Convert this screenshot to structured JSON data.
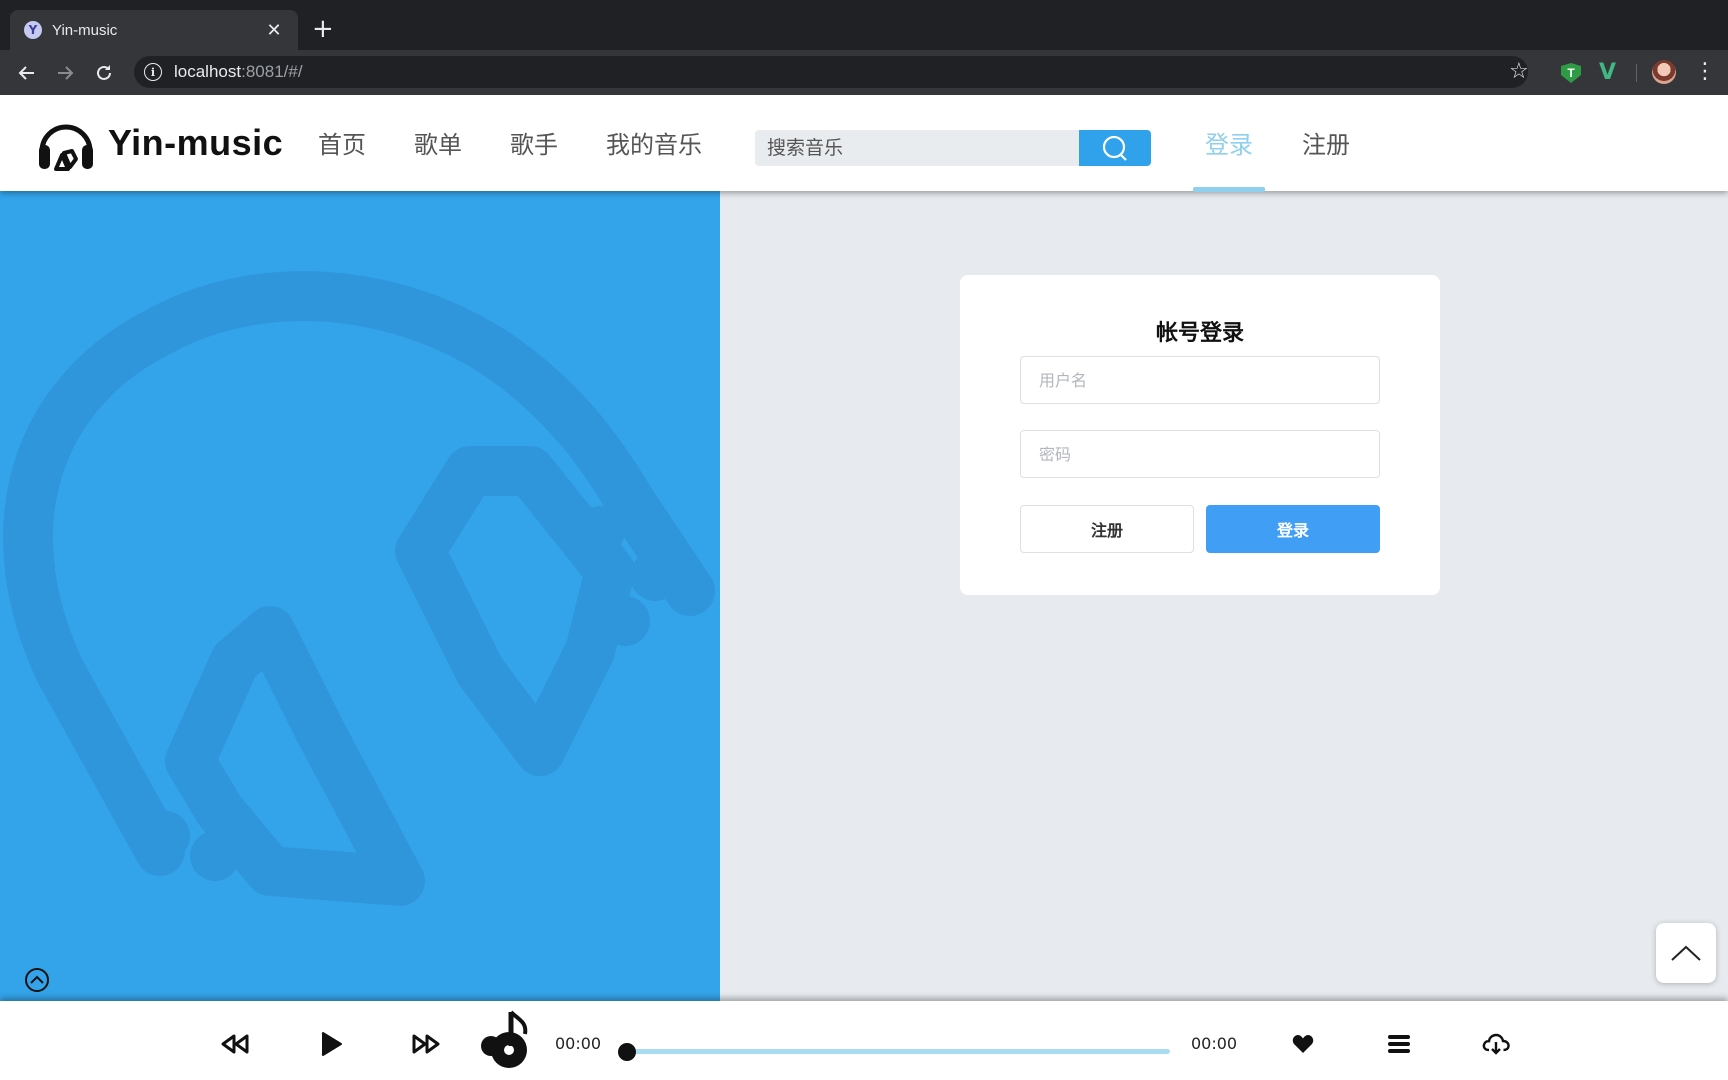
{
  "browser": {
    "tab_title": "Yin-music",
    "favicon_letter": "Y",
    "url_host": "localhost",
    "url_rest": ":8081/#/"
  },
  "header": {
    "logo_text": "Yin-music",
    "nav": [
      "首页",
      "歌单",
      "歌手",
      "我的音乐"
    ],
    "search_placeholder": "搜索音乐",
    "login_link": "登录",
    "register_link": "注册"
  },
  "login": {
    "title": "帐号登录",
    "username_placeholder": "用户名",
    "password_placeholder": "密码",
    "register_button": "注册",
    "login_button": "登录"
  },
  "player": {
    "current_time": "00:00",
    "total_time": "00:00",
    "progress": 0
  },
  "colors": {
    "brand_blue": "#34a4ea",
    "accent_light_blue": "#8fd0ee",
    "primary_button": "#409ef5"
  }
}
